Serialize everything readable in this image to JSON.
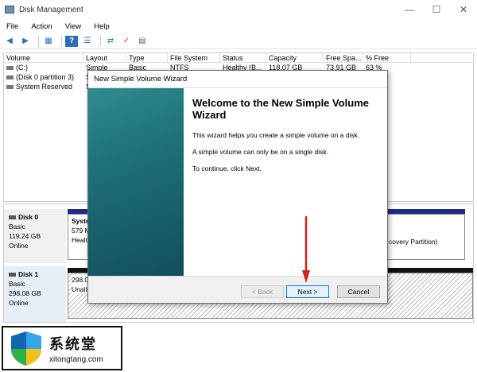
{
  "window": {
    "title": "Disk Management",
    "controls": [
      "—",
      "☐",
      "✕"
    ]
  },
  "menu": [
    "File",
    "Action",
    "View",
    "Help"
  ],
  "toolbar_icons": [
    "back-arrow-icon",
    "forward-arrow-icon",
    "properties-icon",
    "help-icon",
    "list-icon",
    "connect-icon",
    "check-icon",
    "extra-icon"
  ],
  "volumes": {
    "columns": [
      "Volume",
      "Layout",
      "Type",
      "File System",
      "Status",
      "Capacity",
      "Free Spa...",
      "% Free"
    ],
    "rows": [
      [
        "(C:)",
        "Simple",
        "Basic",
        "NTFS",
        "Healthy (B...",
        "118.07 GB",
        "73.91 GB",
        "63 %"
      ],
      [
        "(Disk 0 partition 3)",
        "Si",
        "",
        "",
        "",
        "",
        "",
        ""
      ],
      [
        "System Reserved",
        "Si",
        "",
        "",
        "",
        "",
        "",
        ""
      ]
    ]
  },
  "disks": [
    {
      "name": "Disk 0",
      "type": "Basic",
      "size": "119.24 GB",
      "state": "Online",
      "p1": {
        "line1": "Syste",
        "line2": "579 M",
        "line3": "Healt"
      },
      "p2": {
        "line1": "covery Partition)"
      }
    },
    {
      "name": "Disk 1",
      "type": "Basic",
      "size": "298.08 GB",
      "state": "Online",
      "p1": {
        "line1": "298.08",
        "line2": "Unalloc"
      }
    }
  ],
  "wizard": {
    "title": "New Simple Volume Wizard",
    "heading": "Welcome to the New Simple Volume Wizard",
    "p1": "This wizard helps you create a simple volume on a disk.",
    "p2": "A simple volume can only be on a single disk.",
    "p3": "To continue, click Next.",
    "back": "< Back",
    "next": "Next >",
    "cancel": "Cancel"
  },
  "watermark": {
    "cn": "系统堂",
    "en": "xitongtang.com"
  },
  "colors": {
    "accent": "#0078d7",
    "partition_blue": "#1f2a8c",
    "arrow_red": "#d62020"
  }
}
